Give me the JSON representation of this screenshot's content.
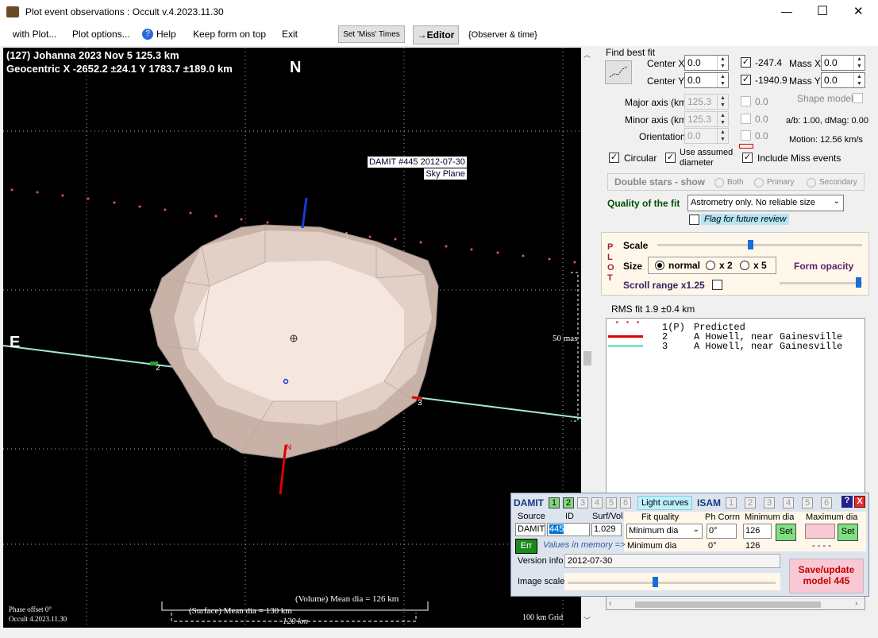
{
  "window": {
    "title": "Plot event observations : Occult v.4.2023.11.30",
    "min": "—",
    "max": "☐",
    "close": "✕"
  },
  "menu": {
    "items": [
      "with Plot...",
      "Plot options...",
      "Help",
      "Keep form on top",
      "Exit"
    ],
    "set_miss": "Set 'Miss' Times",
    "editor": "→Editor",
    "observer": "{Observer & time}"
  },
  "plot": {
    "header1": "(127) Johanna  2023 Nov 5   125.3 km",
    "header2": "Geocentric  X  -2652.2 ±24.1  Y 1783.7 ±189.0 km",
    "north": "N",
    "east": "E",
    "damit_label1": "DAMIT #445 2012-07-30",
    "damit_label2": "Sky Plane",
    "scale_mas": "50 mas",
    "phase_offset": "Phase offset 0°",
    "version": "Occult 4.2023.11.30",
    "volume_dia": "(Volume) Mean dia = 126 km",
    "surface_dia": "(Surface) Mean dia = 130 km",
    "km_scale": "120 km",
    "grid": "100 km Grid",
    "marker1": "1",
    "marker2": "2",
    "marker3": "3",
    "nlabel": "N"
  },
  "fit": {
    "find_best_fit": "Find best fit",
    "center_x_label": "Center X",
    "center_x": "0.0",
    "center_y_label": "Center Y",
    "center_y": "0.0",
    "x_result": "-247.4",
    "y_result": "-1940.9",
    "mass_x_label": "Mass X",
    "mass_x": "0.0",
    "mass_y_label": "Mass Y",
    "mass_y": "0.0",
    "major_label": "Major axis (km)",
    "major": "125.3",
    "major_fit": "0.0",
    "minor_label": "Minor axis (km)",
    "minor": "125.3",
    "minor_fit": "0.0",
    "orient_label": "Orientation",
    "orient": "0.0",
    "orient_fit": "0.0",
    "shape_model": "Shape model",
    "ab": "a/b: 1.00, dMag: 0.00",
    "motion": "Motion: 12.56 km/s",
    "circular": "Circular",
    "use_assumed": "Use assumed",
    "diameter": "diameter",
    "include_miss": "Include Miss events",
    "double_stars": "Double stars - show",
    "both": "Both",
    "primary": "Primary",
    "secondary": "Secondary",
    "quality_label": "Quality of the fit",
    "quality_value": "Astrometry only. No reliable size",
    "flag": "Flag for future review"
  },
  "plotctl": {
    "p": "P",
    "l": "L",
    "o": "O",
    "t": "T",
    "scale": "Scale",
    "size": "Size",
    "normal": "normal",
    "x2": "x 2",
    "x5": "x 5",
    "form_opacity": "Form opacity",
    "scroll_range": "Scroll range x1.25"
  },
  "rms": "RMS fit 1.9 ±0.4 km",
  "legend": [
    {
      "key": "• • •",
      "num": "1(P)",
      "text": "Predicted",
      "color": "#e0508a"
    },
    {
      "key": "",
      "num": "2",
      "text": "A Howell, near Gainesville",
      "color": "#e00000"
    },
    {
      "key": "",
      "num": "3",
      "text": "A Howell, near Gainesville",
      "color": "#7fe6d0"
    }
  ],
  "damit": {
    "title": "DAMIT",
    "nums": [
      "1",
      "2",
      "3",
      "4",
      "5",
      "6"
    ],
    "light_curves": "Light curves",
    "isam": "ISAM",
    "isam_nums": [
      "1",
      "2",
      "3",
      "4",
      "5",
      "6"
    ],
    "help": "?",
    "close": "X",
    "source_label": "Source",
    "id_label": "ID",
    "surf_label": "Surf/Vol",
    "source": "DAMIT",
    "id": "445",
    "surf": "1.029",
    "fit_quality_label": "Fit quality",
    "phcorr_label": "Ph Corrn",
    "min_dia_label": "Minimum dia",
    "max_dia_label": "Maximum dia",
    "fit_quality": "Minimum dia",
    "phcorr": "0°",
    "min_dia": "126",
    "set": "Set",
    "err": "Err",
    "values_mem": "Values in memory =>",
    "mem_fit": "Minimum dia",
    "mem_ph": "0°",
    "mem_min": "126",
    "mem_max": "- - - -",
    "version_label": "Version info",
    "version": "2012-07-30",
    "image_scale": "Image scale",
    "save1": "Save/update",
    "save2": "model 445"
  }
}
